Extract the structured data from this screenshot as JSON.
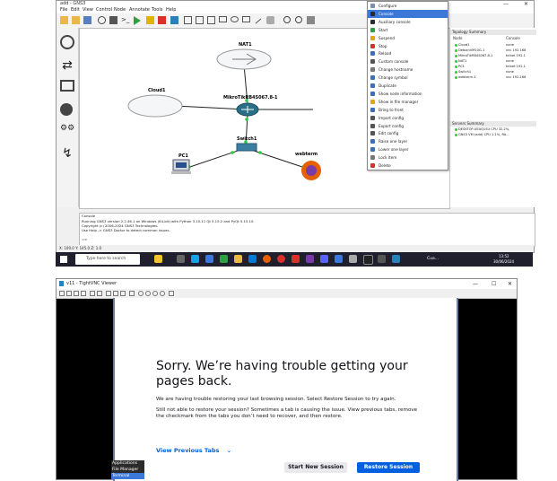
{
  "gns3": {
    "title": "add - GNS3",
    "window_controls": [
      "—",
      "☐",
      "✕"
    ],
    "menus": [
      "File",
      "Edit",
      "View",
      "Control",
      "Node",
      "Annotate",
      "Tools",
      "Help"
    ],
    "nodes": [
      {
        "name": "NAT1"
      },
      {
        "name": "Cloud1"
      },
      {
        "name": "MikroTikRB4S067.8-1"
      },
      {
        "name": "Switch1"
      },
      {
        "name": "PC1"
      },
      {
        "name": "webterm"
      }
    ],
    "topology": {
      "title": "Topology Summary",
      "col_node": "Node",
      "col_console": "Console",
      "rows": [
        {
          "node": "Cloud1",
          "console": "none"
        },
        {
          "node": "DebianVM10G-1",
          "console": "vnc 192.168"
        },
        {
          "node": "MikroTikRB4S067.8-1",
          "console": "telnet 192.1"
        },
        {
          "node": "NAT1",
          "console": "none"
        },
        {
          "node": "PC1",
          "console": "telnet 192.1"
        },
        {
          "node": "Switch1",
          "console": "none"
        },
        {
          "node": "webterm-1",
          "console": "vnc 192.168"
        }
      ]
    },
    "servers": {
      "title": "Servers Summary",
      "rows": [
        {
          "text": "DESKTOP-UEAQ1SU CPU 32.2%,"
        },
        {
          "text": "GNS3 VM (add) CPU 1.1%, RA..."
        }
      ]
    },
    "console": {
      "title": "Console",
      "lines": [
        "Running GNS3 version 2.2.46.1 on Windows (64-bit) with Python 3.10.11 Qt 5.15.2 and PyQt 5.15.10.",
        "Copyright (c) 2006-2024 GNS3 Technologies.",
        "Use Help -> GNS3 Doctor to detect common issues.",
        "",
        "=>"
      ]
    },
    "status": "X: 100.0 Y: 145.0 Z: 1.0",
    "context_menu": [
      {
        "label": "Configure",
        "color": "#7a8fb0"
      },
      {
        "label": "Console",
        "color": "#2a2a2a",
        "selected": true
      },
      {
        "label": "Auxiliary console",
        "color": "#2a2a2a"
      },
      {
        "label": "Start",
        "color": "#2ea043"
      },
      {
        "label": "Suspend",
        "color": "#e0a800"
      },
      {
        "label": "Stop",
        "color": "#d9302c"
      },
      {
        "label": "Reload",
        "color": "#3b6fb6"
      },
      {
        "label": "Custom console",
        "color": "#555555"
      },
      {
        "label": "Change hostname",
        "color": "#777777"
      },
      {
        "label": "Change symbol",
        "color": "#3b6fb6"
      },
      {
        "label": "Duplicate",
        "color": "#3b6fb6"
      },
      {
        "label": "Show node information",
        "color": "#3b6fb6"
      },
      {
        "label": "Show in file manager",
        "color": "#e0a800"
      },
      {
        "label": "Bring to front",
        "color": "#3b6fb6"
      },
      {
        "label": "Import config",
        "color": "#555555"
      },
      {
        "label": "Export config",
        "color": "#555555"
      },
      {
        "label": "Edit config",
        "color": "#555555"
      },
      {
        "label": "Raise one layer",
        "color": "#3b6fb6"
      },
      {
        "label": "Lower one layer",
        "color": "#3b6fb6"
      },
      {
        "label": "Lock item",
        "color": "#777777"
      },
      {
        "label": "Delete",
        "color": "#d9302c"
      }
    ]
  },
  "taskbar": {
    "search_placeholder": "Type here to search",
    "tray_text": "Cua...",
    "time": "13:52",
    "date": "30/06/2024"
  },
  "vnc": {
    "title": "v11 - TightVNC Viewer",
    "window_controls": [
      "—",
      "☐",
      "✕"
    ],
    "page": {
      "heading": "Sorry. We’re having trouble getting your pages back.",
      "para1": "We are having trouble restoring your last browsing session. Select Restore Session to try again.",
      "para2": "Still not able to restore your session? Sometimes a tab is causing the issue. View previous tabs, remove the checkmark from the tabs you don’t need to recover, and then restore.",
      "view_previous": "View Previous Tabs",
      "start_new": "Start New Session",
      "restore": "Restore Session"
    },
    "xfce_menu": [
      "Applications",
      "File Manager",
      "Terminal"
    ]
  },
  "colors": {
    "accent": "#0060df",
    "link_up": "#2ecc40",
    "selected": "#3c78d8"
  }
}
